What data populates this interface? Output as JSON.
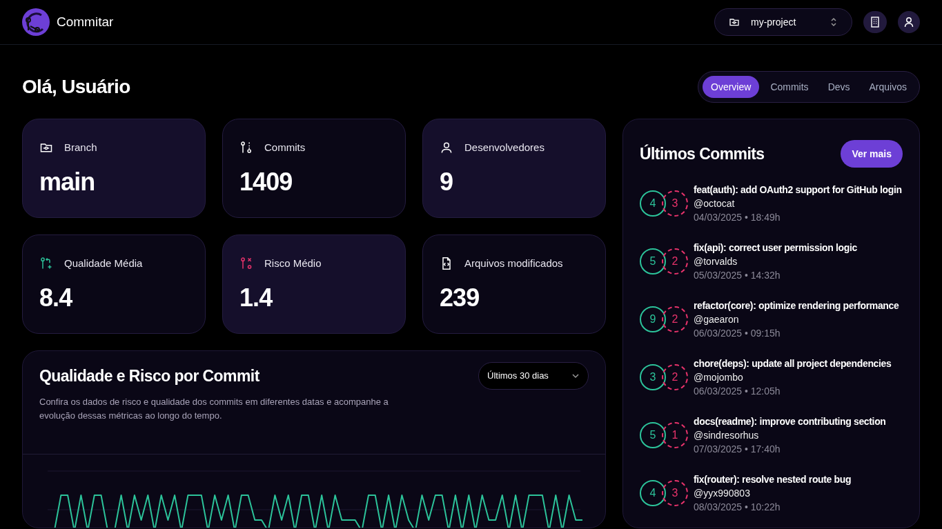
{
  "app": {
    "name": "Commitar"
  },
  "project_select": {
    "value": "my-project"
  },
  "greeting": "Olá, Usuário",
  "tabs": [
    {
      "label": "Overview",
      "selected": true
    },
    {
      "label": "Commits",
      "selected": false
    },
    {
      "label": "Devs",
      "selected": false
    },
    {
      "label": "Arquivos",
      "selected": false
    }
  ],
  "stats": [
    {
      "kind": "branch",
      "label": "Branch",
      "value": "main",
      "highlighted": true
    },
    {
      "kind": "commits",
      "label": "Commits",
      "value": "1409",
      "highlighted": false
    },
    {
      "kind": "developers",
      "label": "Desenvolvedores",
      "value": "9",
      "highlighted": true
    },
    {
      "kind": "quality",
      "label": "Qualidade Média",
      "value": "8.4",
      "highlighted": false
    },
    {
      "kind": "risk",
      "label": "Risco Médio",
      "value": "1.4",
      "highlighted": true
    },
    {
      "kind": "files",
      "label": "Arquivos modificados",
      "value": "239",
      "highlighted": false
    }
  ],
  "chart_card": {
    "title": "Qualidade e Risco por Commit",
    "period_select": {
      "value": "Últimos 30 dias"
    },
    "description": "Confira os dados de risco e qualidade dos commits em diferentes datas e acompanhe a evolução dessas métricas ao longo do tempo."
  },
  "recent_commits": {
    "title": "Últimos Commits",
    "more_button": "Ver mais",
    "items": [
      {
        "quality": "4",
        "risk": "3",
        "message": "feat(auth): add OAuth2 support for GitHub login",
        "author": "@octocat",
        "date": "04/03/2025 • 18:49h"
      },
      {
        "quality": "5",
        "risk": "2",
        "message": "fix(api): correct user permission logic",
        "author": "@torvalds",
        "date": "05/03/2025 • 14:32h"
      },
      {
        "quality": "9",
        "risk": "2",
        "message": "refactor(core): optimize rendering performance",
        "author": "@gaearon",
        "date": "06/03/2025 • 09:15h"
      },
      {
        "quality": "3",
        "risk": "2",
        "message": "chore(deps): update all project dependencies",
        "author": "@mojombo",
        "date": "06/03/2025 • 12:05h"
      },
      {
        "quality": "5",
        "risk": "1",
        "message": "docs(readme): improve contributing section",
        "author": "@sindresorhus",
        "date": "07/03/2025 • 17:40h"
      },
      {
        "quality": "4",
        "risk": "3",
        "message": "fix(router): resolve nested route bug",
        "author": "@yyx990803",
        "date": "08/03/2025 • 10:22h"
      }
    ]
  }
}
